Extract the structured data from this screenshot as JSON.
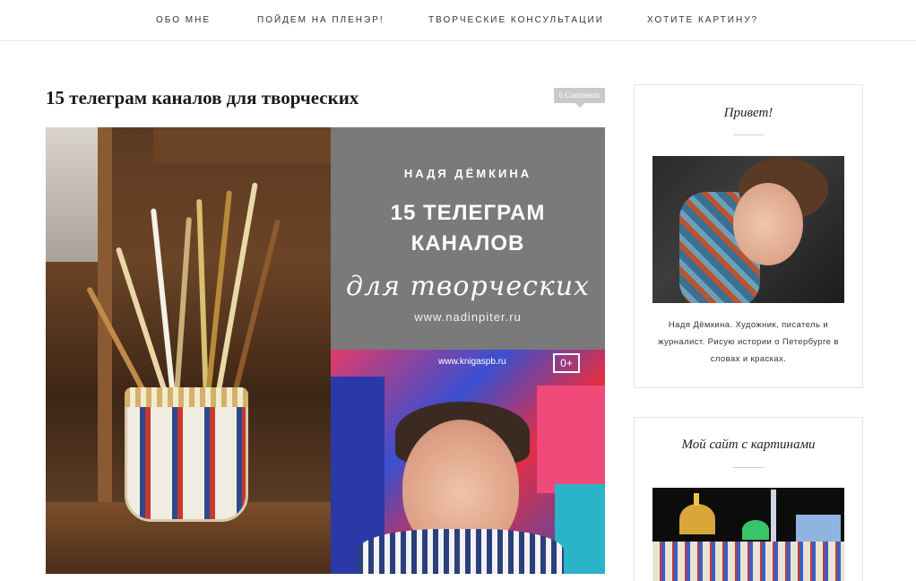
{
  "nav": {
    "items": [
      "ОБО МНЕ",
      "ПОЙДЕМ НА ПЛЕНЭР!",
      "ТВОРЧЕСКИЕ КОНСУЛЬТАЦИИ",
      "ХОТИТЕ КАРТИНУ?"
    ]
  },
  "post": {
    "title": "15 телеграм каналов для творческих",
    "comments": "6 Comments",
    "image": {
      "author": "НАДЯ ДЁМКИНА",
      "title_line1": "15 ТЕЛЕГРАМ",
      "title_line2": "КАНАЛОВ",
      "script_line": "для творческих",
      "site": "www.nadinpiter.ru",
      "poster_url": "www.knigaspb.ru",
      "age_rating": "0+"
    }
  },
  "sidebar": {
    "about": {
      "title": "Привет!",
      "bio": "Надя Дёмкина. Художник, писатель и журналист. Рисую истории о Петербурге в словах и красках."
    },
    "site": {
      "title": "Мой сайт с картинами"
    }
  },
  "colors": {
    "accent_badge": "#c9c9c9",
    "graphic_grey": "#7a7a7a",
    "border": "#e4e4e4"
  }
}
